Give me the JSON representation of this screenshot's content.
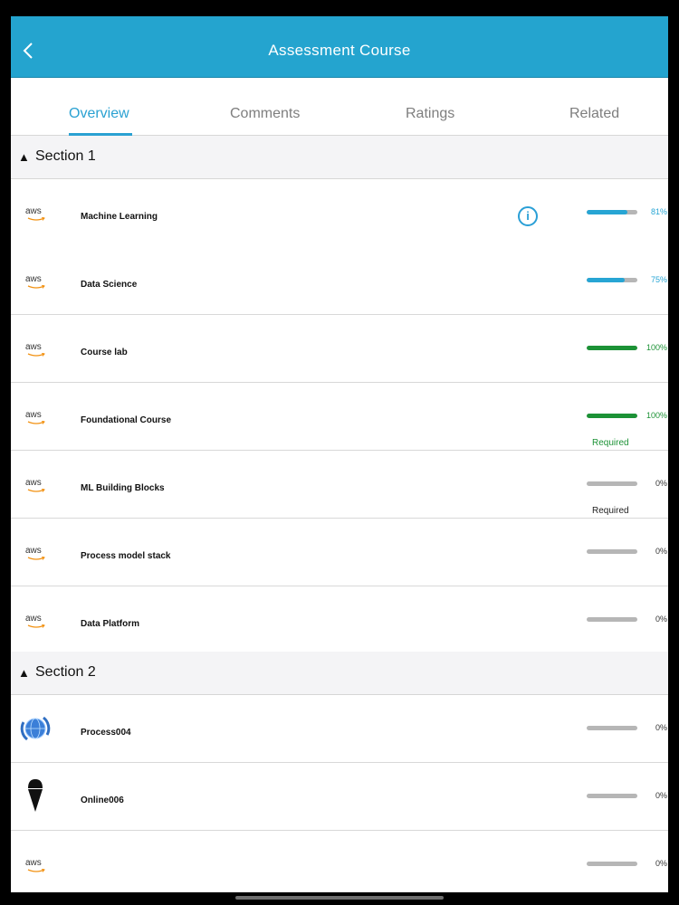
{
  "header": {
    "title": "Assessment Course"
  },
  "tabs": [
    {
      "label": "Overview",
      "active": true
    },
    {
      "label": "Comments",
      "active": false
    },
    {
      "label": "Ratings",
      "active": false
    },
    {
      "label": "Related",
      "active": false
    }
  ],
  "sections": [
    {
      "title": "Section 1",
      "items": [
        {
          "icon": "aws-logo",
          "icon_text": "aws",
          "name": "Machine Learning",
          "progress": 0.81,
          "percent_label": "81%",
          "bar_color": "#27a5d4",
          "info": true,
          "required": ""
        },
        {
          "icon": "aws-logo",
          "icon_text": "aws",
          "name": "Data Science",
          "progress": 0.75,
          "percent_label": "75%",
          "bar_color": "#27a5d4",
          "required": ""
        },
        {
          "icon": "aws-logo",
          "icon_text": "aws",
          "name": "Course lab",
          "progress": 1.0,
          "percent_label": "100%",
          "bar_color": "#1c9236",
          "required": ""
        },
        {
          "icon": "aws-logo",
          "icon_text": "aws",
          "name": "Foundational Course",
          "progress": 1.0,
          "percent_label": "100%",
          "bar_color": "#1c9236",
          "required": "Required",
          "required_color": "#1c9236"
        },
        {
          "icon": "aws-logo",
          "icon_text": "aws",
          "name": "ML Building Blocks",
          "progress": 0,
          "percent_label": "0%",
          "bar_color": "#b6b6b6",
          "required": "Required",
          "required_color": "#222222"
        },
        {
          "icon": "aws-logo",
          "icon_text": "aws",
          "name": "Process model stack",
          "progress": 0,
          "percent_label": "0%",
          "bar_color": "#b6b6b6",
          "required": ""
        },
        {
          "icon": "aws-logo",
          "icon_text": "aws",
          "name": "Data Platform",
          "progress": 0,
          "percent_label": "0%",
          "bar_color": "#b6b6b6",
          "required": ""
        }
      ]
    },
    {
      "title": "Section 2",
      "items": [
        {
          "icon": "globe-sync-icon",
          "icon_text": "",
          "name": "Process004",
          "progress": 0,
          "percent_label": "0%",
          "bar_color": "#b6b6b6",
          "required": ""
        },
        {
          "icon": "ice-cream-icon",
          "icon_text": "",
          "name": "Online006",
          "progress": 0,
          "percent_label": "0%",
          "bar_color": "#b6b6b6",
          "required": ""
        },
        {
          "icon": "aws-logo",
          "icon_text": "aws",
          "name": "",
          "progress": 0,
          "percent_label": "0%",
          "bar_color": "#b6b6b6",
          "required": ""
        }
      ]
    }
  ],
  "colors": {
    "header": "#24a4cf",
    "accent": "#2aa1d2",
    "complete": "#1c9236"
  }
}
